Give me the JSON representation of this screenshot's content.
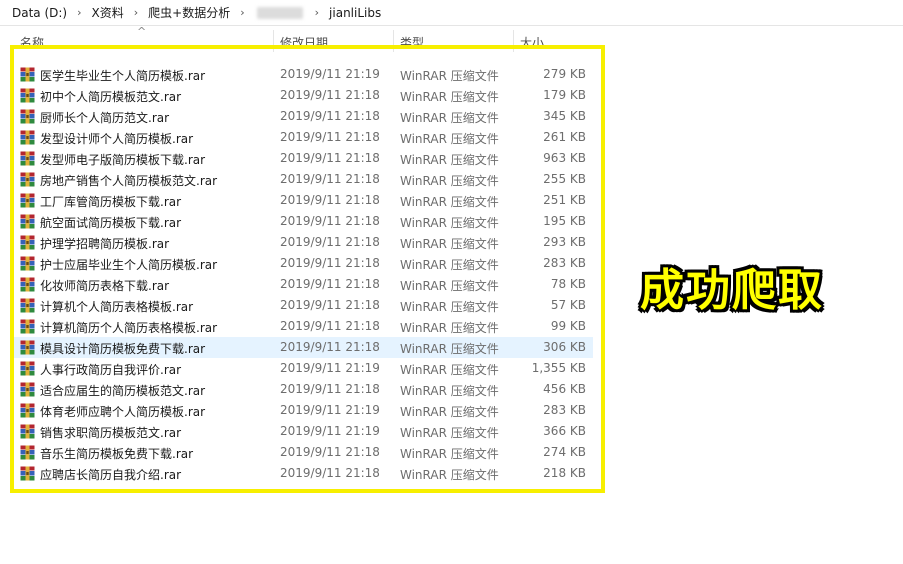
{
  "breadcrumb": {
    "items": [
      "Data (D:)",
      "X资料",
      "爬虫+数据分析",
      "",
      "jianliLibs"
    ]
  },
  "columns": {
    "name": "名称",
    "date": "修改日期",
    "type": "类型",
    "size": "大小"
  },
  "files": [
    {
      "name": "医学生毕业生个人简历模板.rar",
      "date": "2019/9/11 21:19",
      "type": "WinRAR 压缩文件",
      "size": "279 KB",
      "hovered": false
    },
    {
      "name": "初中个人简历模板范文.rar",
      "date": "2019/9/11 21:18",
      "type": "WinRAR 压缩文件",
      "size": "179 KB",
      "hovered": false
    },
    {
      "name": "厨师长个人简历范文.rar",
      "date": "2019/9/11 21:18",
      "type": "WinRAR 压缩文件",
      "size": "345 KB",
      "hovered": false
    },
    {
      "name": "发型设计师个人简历模板.rar",
      "date": "2019/9/11 21:18",
      "type": "WinRAR 压缩文件",
      "size": "261 KB",
      "hovered": false
    },
    {
      "name": "发型师电子版简历模板下载.rar",
      "date": "2019/9/11 21:18",
      "type": "WinRAR 压缩文件",
      "size": "963 KB",
      "hovered": false
    },
    {
      "name": "房地产销售个人简历模板范文.rar",
      "date": "2019/9/11 21:18",
      "type": "WinRAR 压缩文件",
      "size": "255 KB",
      "hovered": false
    },
    {
      "name": "工厂库管简历模板下载.rar",
      "date": "2019/9/11 21:18",
      "type": "WinRAR 压缩文件",
      "size": "251 KB",
      "hovered": false
    },
    {
      "name": "航空面试简历模板下载.rar",
      "date": "2019/9/11 21:18",
      "type": "WinRAR 压缩文件",
      "size": "195 KB",
      "hovered": false
    },
    {
      "name": "护理学招聘简历模板.rar",
      "date": "2019/9/11 21:18",
      "type": "WinRAR 压缩文件",
      "size": "293 KB",
      "hovered": false
    },
    {
      "name": "护士应届毕业生个人简历模板.rar",
      "date": "2019/9/11 21:18",
      "type": "WinRAR 压缩文件",
      "size": "283 KB",
      "hovered": false
    },
    {
      "name": "化妆师简历表格下载.rar",
      "date": "2019/9/11 21:18",
      "type": "WinRAR 压缩文件",
      "size": "78 KB",
      "hovered": false
    },
    {
      "name": "计算机个人简历表格模板.rar",
      "date": "2019/9/11 21:18",
      "type": "WinRAR 压缩文件",
      "size": "57 KB",
      "hovered": false
    },
    {
      "name": "计算机简历个人简历表格模板.rar",
      "date": "2019/9/11 21:18",
      "type": "WinRAR 压缩文件",
      "size": "99 KB",
      "hovered": false
    },
    {
      "name": "模具设计简历模板免费下载.rar",
      "date": "2019/9/11 21:18",
      "type": "WinRAR 压缩文件",
      "size": "306 KB",
      "hovered": true
    },
    {
      "name": "人事行政简历自我评价.rar",
      "date": "2019/9/11 21:19",
      "type": "WinRAR 压缩文件",
      "size": "1,355 KB",
      "hovered": false
    },
    {
      "name": "适合应届生的简历模板范文.rar",
      "date": "2019/9/11 21:18",
      "type": "WinRAR 压缩文件",
      "size": "456 KB",
      "hovered": false
    },
    {
      "name": "体育老师应聘个人简历模板.rar",
      "date": "2019/9/11 21:19",
      "type": "WinRAR 压缩文件",
      "size": "283 KB",
      "hovered": false
    },
    {
      "name": "销售求职简历模板范文.rar",
      "date": "2019/9/11 21:19",
      "type": "WinRAR 压缩文件",
      "size": "366 KB",
      "hovered": false
    },
    {
      "name": "音乐生简历模板免费下载.rar",
      "date": "2019/9/11 21:18",
      "type": "WinRAR 压缩文件",
      "size": "274 KB",
      "hovered": false
    },
    {
      "name": "应聘店长简历自我介绍.rar",
      "date": "2019/9/11 21:18",
      "type": "WinRAR 压缩文件",
      "size": "218 KB",
      "hovered": false
    }
  ],
  "annotation": {
    "text": "成功爬取"
  },
  "colors": {
    "highlight_frame": "#f7ef00",
    "annotation_fill": "#ffff00",
    "hover_row": "#e5f3ff"
  }
}
